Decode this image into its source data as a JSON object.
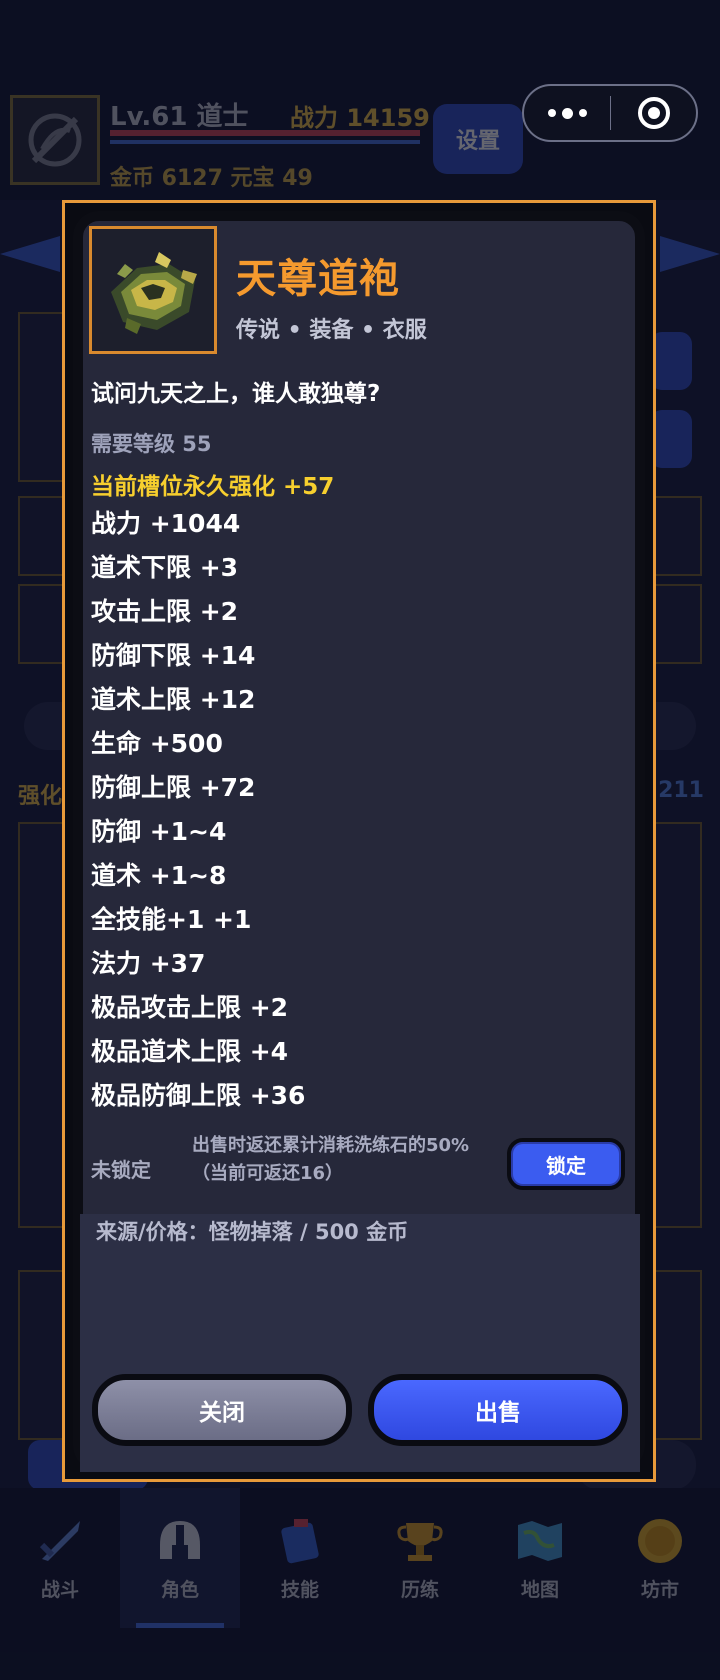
{
  "header": {
    "level_text": "Lv.61 道士",
    "power_text": "战力 14159",
    "coin_text": "金币  6127  元宝  49",
    "settings_label": "设置"
  },
  "background": {
    "enhance_label": "强化",
    "number_text": "211"
  },
  "item": {
    "name": "天尊道袍",
    "type": "传说 • 装备 • 衣服",
    "description": "试问九天之上，谁人敢独尊?",
    "required_level": "需要等级 55",
    "enhancement": "当前槽位永久强化 +57",
    "stats": [
      "战力 +1044",
      "道术下限 +3",
      "攻击上限 +2",
      "防御下限 +14",
      "道术上限 +12",
      "生命 +500",
      "防御上限 +72",
      "防御 +1~4",
      "道术 +1~8",
      "全技能+1 +1",
      "法力 +37",
      "极品攻击上限 +2",
      "极品道术上限 +4",
      "极品防御上限 +36"
    ],
    "lock_status": "未锁定",
    "lock_note_line1": "出售时返还累计消耗洗练石的50%",
    "lock_note_line2": "（当前可返还16）",
    "lock_button": "锁定",
    "source": "来源/价格：怪物掉落 / 500 金币",
    "close_button": "关闭",
    "sell_button": "出售"
  },
  "bottom_nav": [
    {
      "label": "战斗",
      "icon": "sword-icon",
      "active": false
    },
    {
      "label": "角色",
      "icon": "helmet-icon",
      "active": true
    },
    {
      "label": "技能",
      "icon": "skill-book-icon",
      "active": false
    },
    {
      "label": "历练",
      "icon": "trophy-icon",
      "active": false
    },
    {
      "label": "地图",
      "icon": "map-icon",
      "active": false
    },
    {
      "label": "坊市",
      "icon": "coin-icon",
      "active": false
    }
  ],
  "colors": {
    "accent_orange": "#e89a3a",
    "item_name": "#f59a2e",
    "enhance_yellow": "#f7cf2e",
    "primary_blue": "#3b5cf0"
  }
}
